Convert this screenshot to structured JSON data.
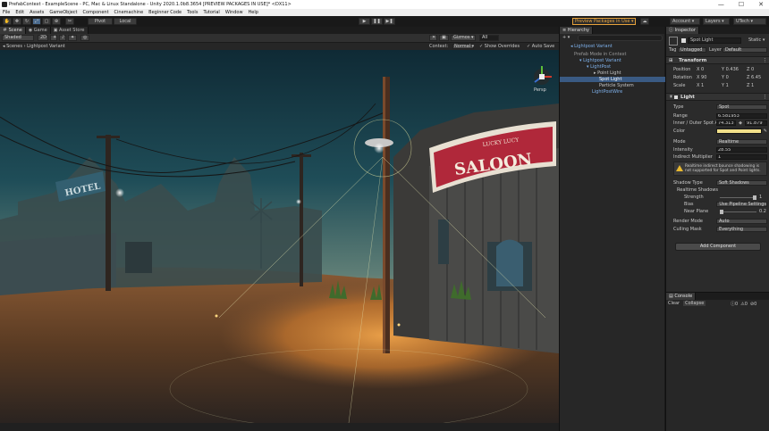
{
  "window": {
    "title": "PrefabContext - ExampleScene - PC, Mac & Linux Standalone - Unity 2020.1.0b8.3654 [PREVIEW PACKAGES IN USE]* <DX11>",
    "minimize": "—",
    "maximize": "☐",
    "close": "✕"
  },
  "menu": [
    "File",
    "Edit",
    "Assets",
    "GameObject",
    "Component",
    "Cinemachine",
    "Beginner Code",
    "Tools",
    "Tutorial",
    "Window",
    "Help"
  ],
  "toolbar": {
    "pivot": "Pivot",
    "local": "Local",
    "play": "▶",
    "pause": "❚❚",
    "step": "▶❚",
    "preview_packages": "Preview Packages in Use",
    "account": "Account",
    "layers": "Layers",
    "layout": "UTech"
  },
  "scene": {
    "tabs": [
      "Scene",
      "Game",
      "Asset Store"
    ],
    "shading": "Shaded",
    "mode_2d": "2D",
    "gizmos": "Gizmos",
    "all": "All",
    "context_label": "Context:",
    "context_value": "Normal",
    "show_overrides": "Show Overrides",
    "auto_save": "Auto Save",
    "breadcrumb_scenes": "Scenes",
    "breadcrumb_item": "Lightpost Variant",
    "persp": "Persp",
    "saloon_top": "LUCKY LUCY",
    "saloon_main": "SALOON",
    "hotel": "HOTEL"
  },
  "hierarchy": {
    "tab": "Hierarchy",
    "add": "+ ▾",
    "root": "Lightpost Variant",
    "items": [
      {
        "label": "Prefab Mode in Context",
        "style": "gray"
      },
      {
        "label": "Lightpost Variant",
        "style": "blue"
      },
      {
        "label": "LightPost",
        "style": "blue"
      },
      {
        "label": "Point Light",
        "style": "normal"
      },
      {
        "label": "Spot Light",
        "style": "selected"
      },
      {
        "label": "Particle System",
        "style": "normal"
      },
      {
        "label": "LightPostWire",
        "style": "blue"
      }
    ]
  },
  "inspector": {
    "tab": "Inspector",
    "object_name": "Spot Light",
    "static": "Static ▾",
    "tag_label": "Tag",
    "tag_value": "Untagged",
    "layer_label": "Layer",
    "layer_value": "Default",
    "transform": {
      "title": "Transform",
      "rows": [
        {
          "label": "Position",
          "x": "0",
          "y": "0.436",
          "z": "0"
        },
        {
          "label": "Rotation",
          "x": "90",
          "y": "0",
          "z": "6.45"
        },
        {
          "label": "Scale",
          "x": "1",
          "y": "1",
          "z": "1"
        }
      ]
    },
    "light": {
      "title": "Light",
      "type_label": "Type",
      "type_value": "Spot",
      "range_label": "Range",
      "range_value": "6.581953",
      "angle_label": "Inner / Outer Spot An",
      "inner_value": "74.313",
      "outer_value": "91.879",
      "color_label": "Color",
      "color_hex": "#f2e08a",
      "mode_label": "Mode",
      "mode_value": "Realtime",
      "intensity_label": "Intensity",
      "intensity_value": "28.55",
      "indirect_label": "Indirect Multiplier",
      "indirect_value": "1",
      "warning": "Realtime indirect bounce shadowing is not supported for Spot and Point lights.",
      "shadow_type_label": "Shadow Type",
      "shadow_type_value": "Soft Shadows",
      "realtime_shadows": "Realtime Shadows",
      "strength_label": "Strength",
      "strength_value": "1",
      "bias_label": "Bias",
      "bias_value": "Use Pipeline Settings",
      "near_plane_label": "Near Plane",
      "near_plane_value": "0.2",
      "render_mode_label": "Render Mode",
      "render_mode_value": "Auto",
      "culling_label": "Culling Mask",
      "culling_value": "Everything"
    },
    "add_component": "Add Component"
  },
  "console": {
    "tab": "Console",
    "clear": "Clear",
    "collapse": "Collapse",
    "err_count": "0",
    "warn_count": "0",
    "info_count": "0"
  },
  "colors": {
    "accent": "#3a5a83",
    "warning": "#e8b930",
    "preview_border": "#e7a23b"
  }
}
